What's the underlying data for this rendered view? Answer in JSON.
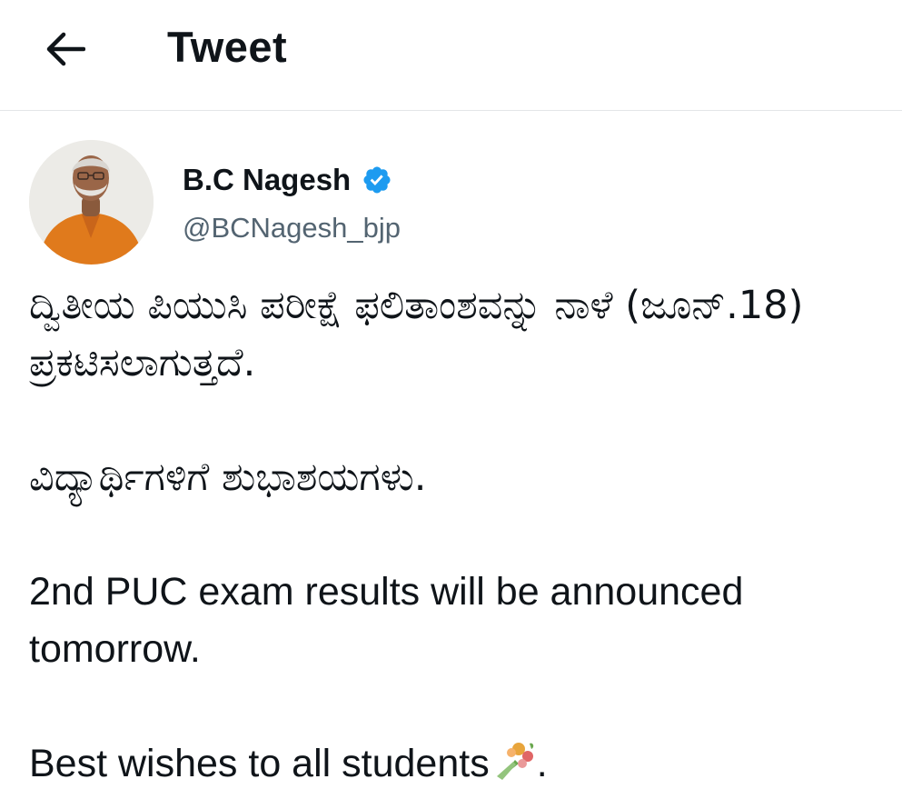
{
  "header": {
    "title": "Tweet",
    "back_icon": "arrow-left-icon"
  },
  "author": {
    "display_name": "B.C Nagesh",
    "handle": "@BCNagesh_bjp",
    "verified_icon": "verified-badge-icon",
    "verified_color": "#1d9bf0"
  },
  "tweet": {
    "kannada_line_1": "ದ್ವಿತೀಯ ಪಿಯುಸಿ ಪರೀಕ್ಷೆ ಫಲಿತಾಂಶವನ್ನು ನಾಳೆ (ಜೂನ್.18) ಪ್ರಕಟಿಸಲಾಗುತ್ತದೆ.",
    "kannada_line_2": "ವಿದ್ಯಾರ್ಥಿಗಳಿಗೆ ಶುಭಾಶಯಗಳು.",
    "english_line_1": "2nd PUC exam results will be announced tomorrow.",
    "english_line_2": "Best wishes to all students",
    "english_line_2_suffix": ".",
    "emoji_icon": "bouquet-icon"
  },
  "colors": {
    "text": "#0f1419",
    "secondary_text": "#536471",
    "divider": "#e3e6e8"
  }
}
